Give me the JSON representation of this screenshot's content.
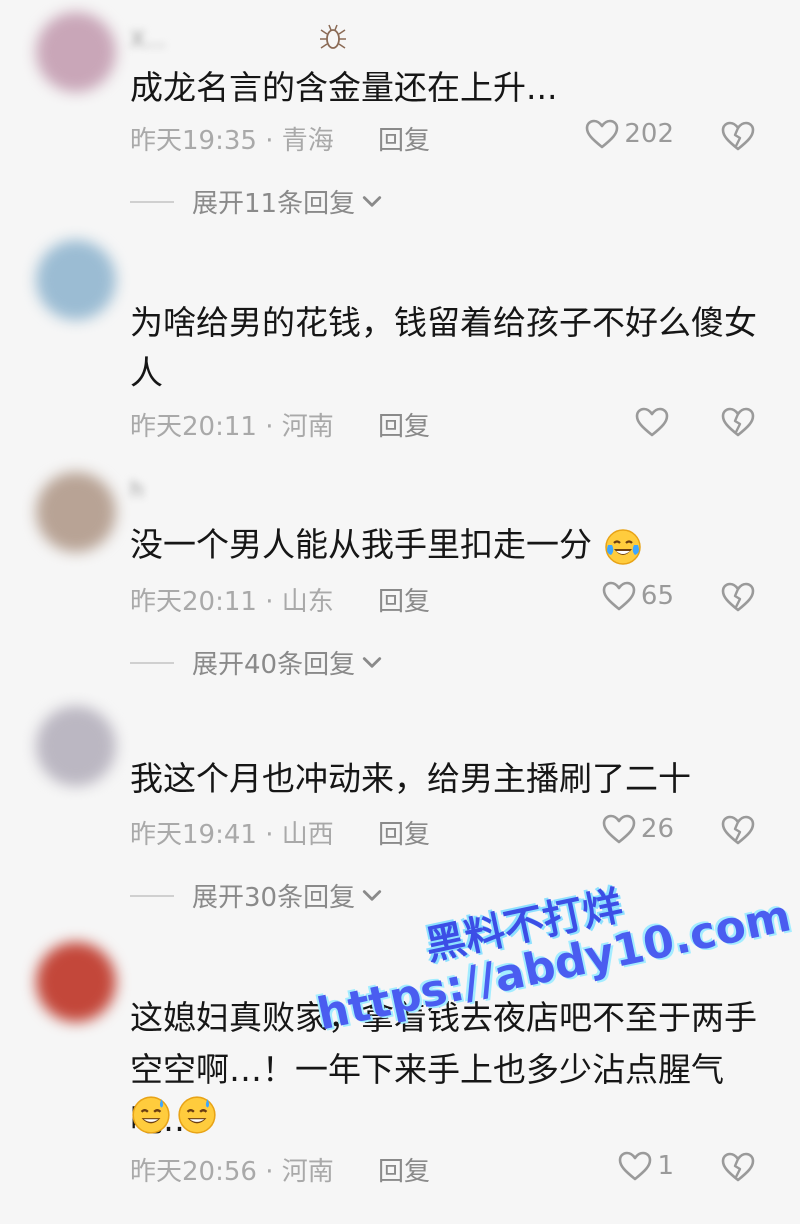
{
  "comments": [
    {
      "username": "X...",
      "text": "成龙名言的含金量还在上升...",
      "time": "昨天19:35",
      "location": "青海",
      "reply": "回复",
      "likes": "202",
      "expand": "展开11条回复",
      "avatar_color": "#c4a7b6"
    },
    {
      "username": "",
      "text": "为啥给男的花钱，钱留着给孩子不好么傻女人",
      "time": "昨天20:11",
      "location": "河南",
      "reply": "回复",
      "likes": "",
      "expand": "",
      "avatar_color": "#8fb4cc"
    },
    {
      "username": "h",
      "text": "没一个男人能从我手里扣走一分",
      "time": "昨天20:11",
      "location": "山东",
      "reply": "回复",
      "likes": "65",
      "expand": "展开40条回复",
      "avatar_color": "#b3a195"
    },
    {
      "username": "",
      "text": "我这个月也冲动来，给男主播刷了二十",
      "time": "昨天19:41",
      "location": "山西",
      "reply": "回复",
      "likes": "26",
      "expand": "展开30条回复",
      "avatar_color": "#b9b5bf"
    },
    {
      "username": "",
      "text_line1": "这媳妇真败家，拿着钱去夜店吧不至于两手",
      "text_line2": "空空啊…！一年下来手上也多少沾点腥气吧…",
      "time": "昨天20:56",
      "location": "河南",
      "reply": "回复",
      "likes": "1",
      "avatar_color": "#c24a3c"
    }
  ],
  "separator": "·",
  "watermark": {
    "line1": "黑料不打烊",
    "line2": "https://abdy10.com"
  },
  "colors": {
    "background": "#f6f6f6",
    "text": "#161616",
    "meta": "#a9a9a9",
    "watermark": "#3c4ee6"
  },
  "icons": [
    "bug-icon",
    "heart-icon",
    "broken-heart-icon",
    "chevron-down-icon",
    "crying-laughing-emoji",
    "sweat-smile-emoji"
  ]
}
